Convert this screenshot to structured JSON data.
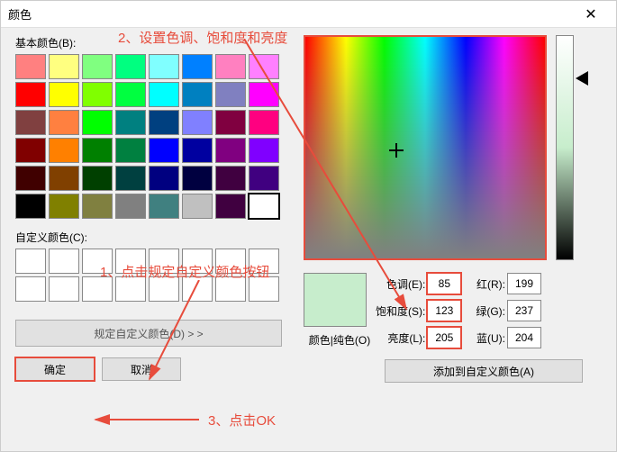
{
  "title": "颜色",
  "annotations": {
    "step1": "1、点击规定自定义颜色按钮",
    "step2": "2、设置色调、饱和度和亮度",
    "step3": "3、点击OK"
  },
  "labels": {
    "basic": "基本颜色(B):",
    "custom": "自定义颜色(C):",
    "define": "规定自定义颜色(D) > >",
    "ok": "确定",
    "cancel": "取消",
    "preview": "颜色|纯色(O)",
    "hue": "色调(E):",
    "sat": "饱和度(S):",
    "lum": "亮度(L):",
    "red": "红(R):",
    "green": "绿(G):",
    "blue": "蓝(U):",
    "add": "添加到自定义颜色(A)"
  },
  "values": {
    "hue": "85",
    "sat": "123",
    "lum": "205",
    "red": "199",
    "green": "237",
    "blue": "204",
    "preview_color": "#c7edcc"
  },
  "basic_colors": [
    "#ff8080",
    "#ffff80",
    "#80ff80",
    "#00ff80",
    "#80ffff",
    "#0080ff",
    "#ff80c0",
    "#ff80ff",
    "#ff0000",
    "#ffff00",
    "#80ff00",
    "#00ff40",
    "#00ffff",
    "#0080c0",
    "#8080c0",
    "#ff00ff",
    "#804040",
    "#ff8040",
    "#00ff00",
    "#008080",
    "#004080",
    "#8080ff",
    "#800040",
    "#ff0080",
    "#800000",
    "#ff8000",
    "#008000",
    "#008040",
    "#0000ff",
    "#0000a0",
    "#800080",
    "#8000ff",
    "#400000",
    "#804000",
    "#004000",
    "#004040",
    "#000080",
    "#000040",
    "#400040",
    "#400080",
    "#000000",
    "#808000",
    "#808040",
    "#808080",
    "#408080",
    "#c0c0c0",
    "#400040",
    "#ffffff"
  ]
}
